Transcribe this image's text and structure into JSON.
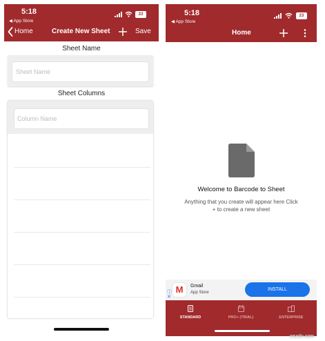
{
  "left": {
    "status": {
      "time": "5:18",
      "back_app": "◀ App Store",
      "battery": "23"
    },
    "nav": {
      "back_label": "Home",
      "title": "Create New Sheet",
      "add": "+",
      "save_label": "Save"
    },
    "sheet_name": {
      "label": "Sheet Name",
      "placeholder": "Sheet Name"
    },
    "sheet_columns": {
      "label": "Sheet Columns",
      "placeholder": "Column Name"
    }
  },
  "right": {
    "status": {
      "time": "5:18",
      "back_app": "◀ App Store",
      "battery": "23"
    },
    "nav": {
      "title": "Home",
      "add": "+",
      "more": "⋮"
    },
    "empty": {
      "title": "Welcome to Barcode to Sheet",
      "line1": "Anything that you create will appear here Click",
      "line2": "+ to create a new sheet"
    },
    "ad": {
      "app_name": "Gmail",
      "store": "App Store",
      "install_label": "INSTALL",
      "brand_letter": "M"
    },
    "tabs": [
      {
        "label": "STANDARD",
        "active": true
      },
      {
        "label": "PRO+ (TRIAL)",
        "active": false
      },
      {
        "label": "ENTERPRISE",
        "active": false
      }
    ]
  },
  "watermark": "wsxdn.com",
  "colors": {
    "brand_red": "#a12a2c",
    "install_blue": "#1a73e8",
    "doc_icon": "#6a6a6a"
  }
}
